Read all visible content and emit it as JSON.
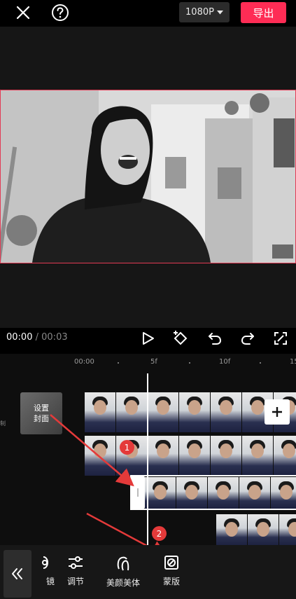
{
  "topbar": {
    "close_icon": "close-icon",
    "help_icon": "help-icon",
    "resolution": "1080P",
    "export_label": "导出"
  },
  "playback": {
    "current_time": "00:00",
    "separator": "/",
    "total_time": "00:03"
  },
  "ruler": {
    "labels": [
      "00:00",
      "5f",
      "10f",
      "15"
    ]
  },
  "timeline": {
    "cover_label_line1": "设置",
    "cover_label_line2": "封面",
    "left_stub_text": "制"
  },
  "annotations": {
    "badge_1": "1",
    "badge_2": "2"
  },
  "toolbar": {
    "partial_label": "镜",
    "adjust_label": "调节",
    "beauty_label": "美颜美体",
    "mask_label": "蒙版"
  },
  "colors": {
    "accent": "#fe2c55",
    "frame_border": "#e33a54",
    "annotation_red": "#e43a3a"
  }
}
